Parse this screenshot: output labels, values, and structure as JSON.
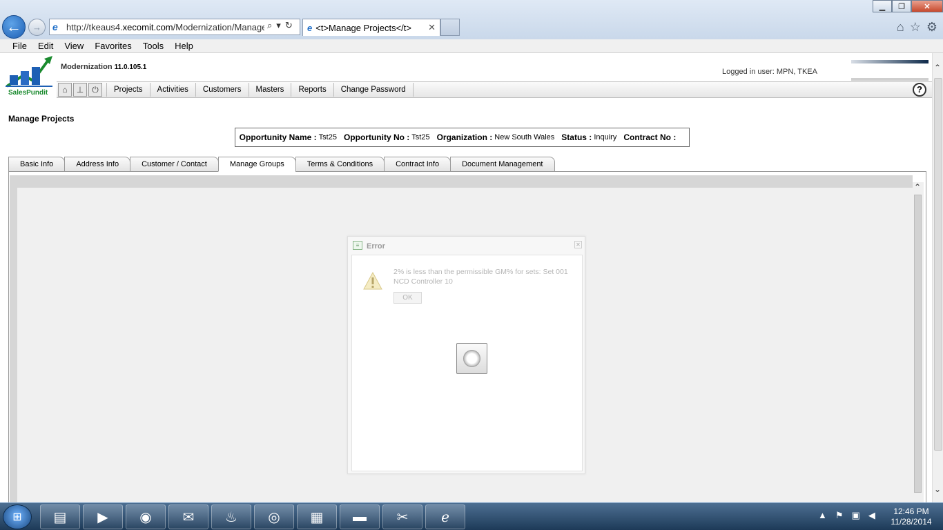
{
  "browser": {
    "address_prefix": "http://tkeaus4.",
    "address_domain": "xecomit.com",
    "address_suffix": "/Modernization/ManageC",
    "tab_title": "<t>Manage Projects</t>",
    "menu": [
      "File",
      "Edit",
      "View",
      "Favorites",
      "Tools",
      "Help"
    ]
  },
  "app": {
    "logo_text": "SalesPundit",
    "title": "Modernization",
    "version": "11.0.105.1",
    "logged_in": "Logged in user: MPN, TKEA",
    "nav": [
      "Projects",
      "Activities",
      "Customers",
      "Masters",
      "Reports",
      "Change Password"
    ],
    "help_label": "?"
  },
  "page": {
    "title": "Manage Projects",
    "info": {
      "opp_name_label": "Opportunity Name :",
      "opp_name": "Tst25",
      "opp_no_label": "Opportunity No :",
      "opp_no": "Tst25",
      "org_label": "Organization :",
      "org": "New South Wales",
      "status_label": "Status :",
      "status": "Inquiry",
      "contract_label": "Contract No :",
      "contract": ""
    },
    "tabs": [
      "Basic Info",
      "Address Info",
      "Customer / Contact",
      "Manage Groups",
      "Terms & Conditions",
      "Contract Info",
      "Document Management"
    ],
    "active_tab": "Manage Groups"
  },
  "dialog": {
    "title": "Error",
    "message": "2% is less than the permissible GM% for sets: Set 001 NCD Controller 10",
    "ok": "OK"
  },
  "taskbar": {
    "time": "12:46 PM",
    "date": "11/28/2014"
  },
  "colors": {
    "accent": "#1d5fb4",
    "logo_green": "#1a8a2e"
  }
}
